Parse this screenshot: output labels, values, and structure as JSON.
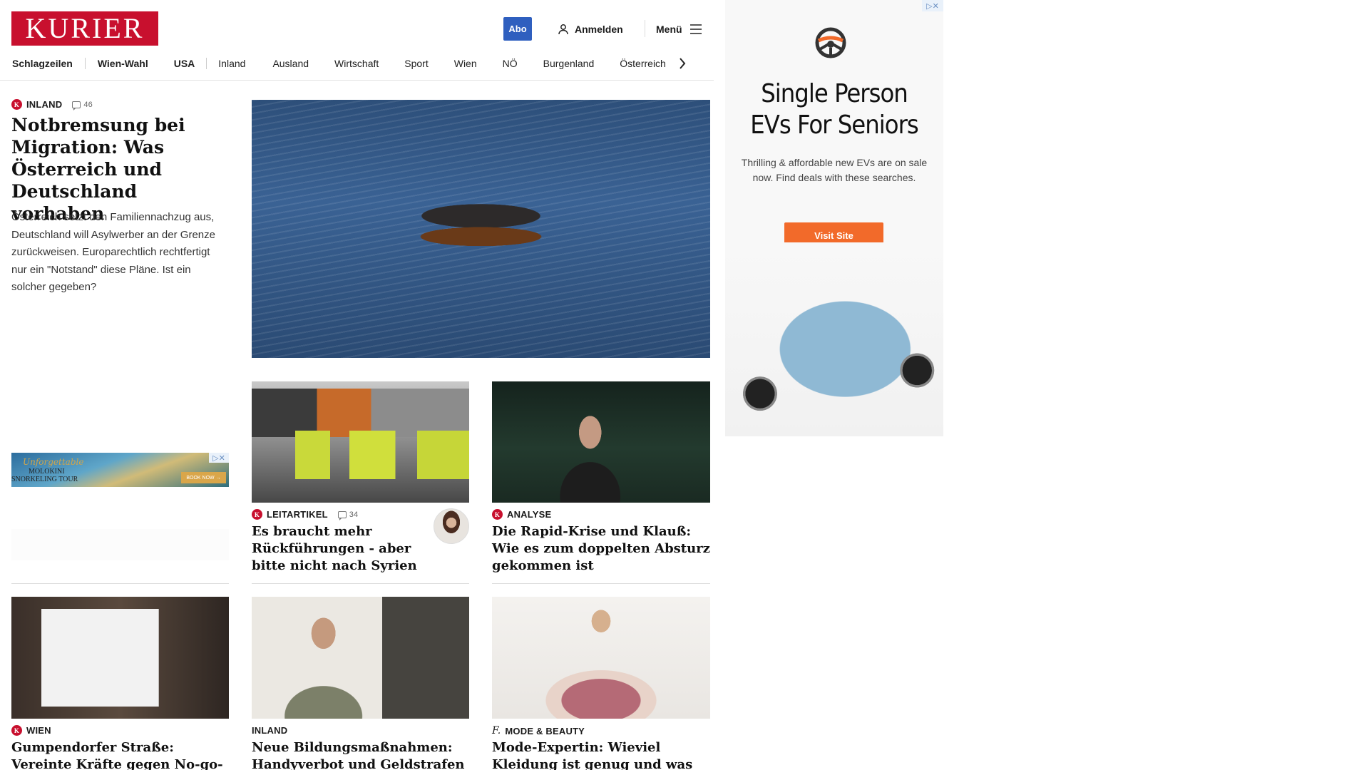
{
  "header": {
    "logo": "KURIER",
    "abo": "Abo",
    "login": "Anmelden",
    "menu": "Menü"
  },
  "nav": [
    "Schlagzeilen",
    "Wien-Wahl",
    "USA",
    "Inland",
    "Ausland",
    "Wirtschaft",
    "Sport",
    "Wien",
    "NÖ",
    "Burgenland",
    "Österreich"
  ],
  "lead": {
    "kicker": "INLAND",
    "comments": "46",
    "title": "Notbremsung bei Migration: Was Österreich und Deutschland vorhaben",
    "teaser": "Österreich setzt den Familiennachzug aus, Deutschland will Asylwerber an der Grenze zurückweisen. Europarechtlich rechtfertigt nur ein \"Notstand\" diese Pläne. Ist ein solcher gegeben?"
  },
  "small_ad": {
    "script": "Unforgettable",
    "line1": "MOLOKINI",
    "line2": "SNORKELING TOUR",
    "button": "BOOK NOW →"
  },
  "cards": [
    {
      "kicker": "LEITARTIKEL",
      "comments": "34",
      "title": "Es braucht mehr Rückführungen - aber bitte nicht nach Syrien"
    },
    {
      "kicker": "ANALYSE",
      "title": "Die Rapid-Krise und Klauß: Wie es zum doppelten Absturz gekommen ist"
    },
    {
      "kicker": "WIEN",
      "title": "Gumpendorfer Straße: Vereinte Kräfte gegen No-go-Zonen"
    },
    {
      "kicker": "INLAND",
      "title": "Neue Bildungsmaßnahmen: Handyverbot und Geldstrafen für Eltern?"
    },
    {
      "kicker": "MODE & BEAUTY",
      "title": "Mode-Expertin: Wieviel Kleidung ist genug und was mit dem Rest?"
    }
  ],
  "ad": {
    "headline": "Single Person EVs For Seniors",
    "sub": "Thrilling & affordable new EVs are on sale now. Find deals with these searches.",
    "button": "Visit Site"
  },
  "colors": {
    "brand": "#c8102e",
    "abo": "#2f5fbf",
    "ad_button": "#f26a2a"
  }
}
